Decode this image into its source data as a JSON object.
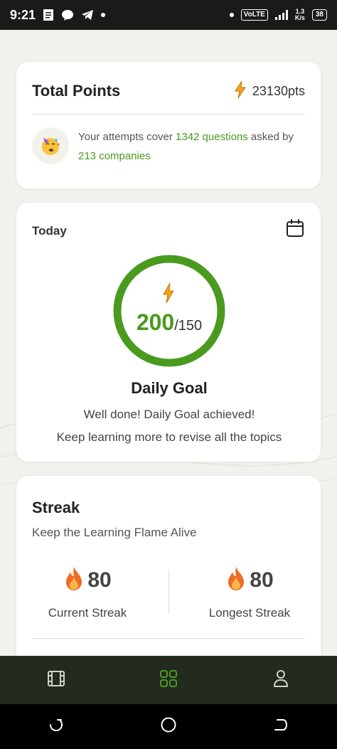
{
  "status_bar": {
    "time": "9:21",
    "network": "VoLTE",
    "speed_value": "1.3",
    "speed_unit": "K/s",
    "battery": "38"
  },
  "points_card": {
    "title": "Total Points",
    "value": "23130pts",
    "attempts_prefix": "Your attempts cover ",
    "questions": "1342 questions",
    "asked_by": " asked by ",
    "companies": "213 companies"
  },
  "today_card": {
    "label": "Today",
    "progress_current": "200",
    "progress_target": "/150",
    "goal_title": "Daily Goal",
    "message_1": "Well done! Daily Goal achieved!",
    "message_2": "Keep learning more to revise all the topics"
  },
  "streak_card": {
    "title": "Streak",
    "subtitle": "Keep the Learning Flame Alive",
    "current_value": "80",
    "current_label": "Current Streak",
    "longest_value": "80",
    "longest_label": "Longest Streak"
  },
  "colors": {
    "accent_green": "#4a9a20",
    "nav_bg": "#232a1f",
    "page_bg": "#f1f2ee"
  },
  "icons": {
    "points": "lightning-icon",
    "avatar": "party-face-icon",
    "calendar": "calendar-icon",
    "streak": "fire-icon",
    "nav_1": "film-icon",
    "nav_2": "grid-icon",
    "nav_3": "person-icon"
  }
}
